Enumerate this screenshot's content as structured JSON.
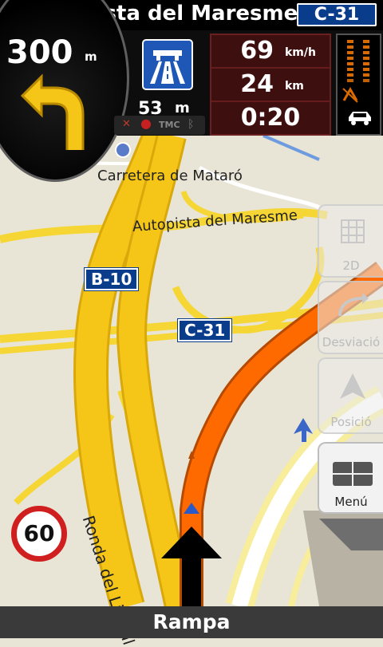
{
  "header": {
    "street_name": "Autopista del Maresme",
    "road_number": "C-31"
  },
  "turn": {
    "distance_value": "300",
    "distance_unit": "m",
    "icon": "turn-left-arrow-icon",
    "sub_distance_value": "53",
    "sub_distance_unit": "m",
    "road_sign_icon": "motorway-sign-icon"
  },
  "status": {
    "tmc_label": "TMC",
    "icons": [
      "satellite-icon",
      "record-dot-icon",
      "bluetooth-icon"
    ]
  },
  "trip": {
    "speed_value": "69",
    "speed_unit": "km/h",
    "distance_value": "24",
    "distance_unit": "km",
    "time_remaining": "0:20"
  },
  "traffic": {
    "icons": [
      "traffic-level-icon",
      "no-traffic-icon",
      "car-icon"
    ]
  },
  "map": {
    "labels": {
      "carretera": "Carretera de Mataró",
      "autopista": "Autopista del Maresme",
      "ronda": "Ronda del Litoral"
    },
    "shields": {
      "b10": "B-10",
      "c31": "C-31"
    }
  },
  "side_buttons": {
    "view_2d": "2D",
    "detour": "Desviació",
    "position": "Posició",
    "menu": "Menú"
  },
  "speed_limit": "60",
  "footer": {
    "next_street": "Rampa"
  },
  "colors": {
    "route": "#ff6a00",
    "major_road": "#f5c518",
    "shield_blue": "#0a3c8c",
    "map_background": "#e9e5d6"
  }
}
